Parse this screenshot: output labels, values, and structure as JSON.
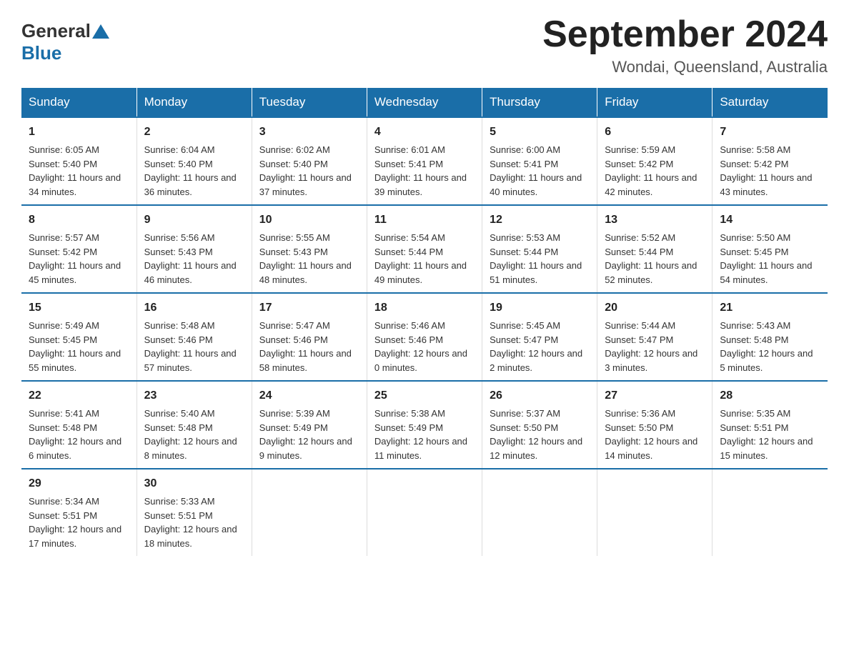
{
  "header": {
    "logo_general": "General",
    "logo_blue": "Blue",
    "month_title": "September 2024",
    "location": "Wondai, Queensland, Australia"
  },
  "weekdays": [
    "Sunday",
    "Monday",
    "Tuesday",
    "Wednesday",
    "Thursday",
    "Friday",
    "Saturday"
  ],
  "weeks": [
    [
      {
        "day": "1",
        "sunrise": "6:05 AM",
        "sunset": "5:40 PM",
        "daylight": "11 hours and 34 minutes."
      },
      {
        "day": "2",
        "sunrise": "6:04 AM",
        "sunset": "5:40 PM",
        "daylight": "11 hours and 36 minutes."
      },
      {
        "day": "3",
        "sunrise": "6:02 AM",
        "sunset": "5:40 PM",
        "daylight": "11 hours and 37 minutes."
      },
      {
        "day": "4",
        "sunrise": "6:01 AM",
        "sunset": "5:41 PM",
        "daylight": "11 hours and 39 minutes."
      },
      {
        "day": "5",
        "sunrise": "6:00 AM",
        "sunset": "5:41 PM",
        "daylight": "11 hours and 40 minutes."
      },
      {
        "day": "6",
        "sunrise": "5:59 AM",
        "sunset": "5:42 PM",
        "daylight": "11 hours and 42 minutes."
      },
      {
        "day": "7",
        "sunrise": "5:58 AM",
        "sunset": "5:42 PM",
        "daylight": "11 hours and 43 minutes."
      }
    ],
    [
      {
        "day": "8",
        "sunrise": "5:57 AM",
        "sunset": "5:42 PM",
        "daylight": "11 hours and 45 minutes."
      },
      {
        "day": "9",
        "sunrise": "5:56 AM",
        "sunset": "5:43 PM",
        "daylight": "11 hours and 46 minutes."
      },
      {
        "day": "10",
        "sunrise": "5:55 AM",
        "sunset": "5:43 PM",
        "daylight": "11 hours and 48 minutes."
      },
      {
        "day": "11",
        "sunrise": "5:54 AM",
        "sunset": "5:44 PM",
        "daylight": "11 hours and 49 minutes."
      },
      {
        "day": "12",
        "sunrise": "5:53 AM",
        "sunset": "5:44 PM",
        "daylight": "11 hours and 51 minutes."
      },
      {
        "day": "13",
        "sunrise": "5:52 AM",
        "sunset": "5:44 PM",
        "daylight": "11 hours and 52 minutes."
      },
      {
        "day": "14",
        "sunrise": "5:50 AM",
        "sunset": "5:45 PM",
        "daylight": "11 hours and 54 minutes."
      }
    ],
    [
      {
        "day": "15",
        "sunrise": "5:49 AM",
        "sunset": "5:45 PM",
        "daylight": "11 hours and 55 minutes."
      },
      {
        "day": "16",
        "sunrise": "5:48 AM",
        "sunset": "5:46 PM",
        "daylight": "11 hours and 57 minutes."
      },
      {
        "day": "17",
        "sunrise": "5:47 AM",
        "sunset": "5:46 PM",
        "daylight": "11 hours and 58 minutes."
      },
      {
        "day": "18",
        "sunrise": "5:46 AM",
        "sunset": "5:46 PM",
        "daylight": "12 hours and 0 minutes."
      },
      {
        "day": "19",
        "sunrise": "5:45 AM",
        "sunset": "5:47 PM",
        "daylight": "12 hours and 2 minutes."
      },
      {
        "day": "20",
        "sunrise": "5:44 AM",
        "sunset": "5:47 PM",
        "daylight": "12 hours and 3 minutes."
      },
      {
        "day": "21",
        "sunrise": "5:43 AM",
        "sunset": "5:48 PM",
        "daylight": "12 hours and 5 minutes."
      }
    ],
    [
      {
        "day": "22",
        "sunrise": "5:41 AM",
        "sunset": "5:48 PM",
        "daylight": "12 hours and 6 minutes."
      },
      {
        "day": "23",
        "sunrise": "5:40 AM",
        "sunset": "5:48 PM",
        "daylight": "12 hours and 8 minutes."
      },
      {
        "day": "24",
        "sunrise": "5:39 AM",
        "sunset": "5:49 PM",
        "daylight": "12 hours and 9 minutes."
      },
      {
        "day": "25",
        "sunrise": "5:38 AM",
        "sunset": "5:49 PM",
        "daylight": "12 hours and 11 minutes."
      },
      {
        "day": "26",
        "sunrise": "5:37 AM",
        "sunset": "5:50 PM",
        "daylight": "12 hours and 12 minutes."
      },
      {
        "day": "27",
        "sunrise": "5:36 AM",
        "sunset": "5:50 PM",
        "daylight": "12 hours and 14 minutes."
      },
      {
        "day": "28",
        "sunrise": "5:35 AM",
        "sunset": "5:51 PM",
        "daylight": "12 hours and 15 minutes."
      }
    ],
    [
      {
        "day": "29",
        "sunrise": "5:34 AM",
        "sunset": "5:51 PM",
        "daylight": "12 hours and 17 minutes."
      },
      {
        "day": "30",
        "sunrise": "5:33 AM",
        "sunset": "5:51 PM",
        "daylight": "12 hours and 18 minutes."
      },
      null,
      null,
      null,
      null,
      null
    ]
  ],
  "labels": {
    "sunrise": "Sunrise:",
    "sunset": "Sunset:",
    "daylight": "Daylight:"
  }
}
